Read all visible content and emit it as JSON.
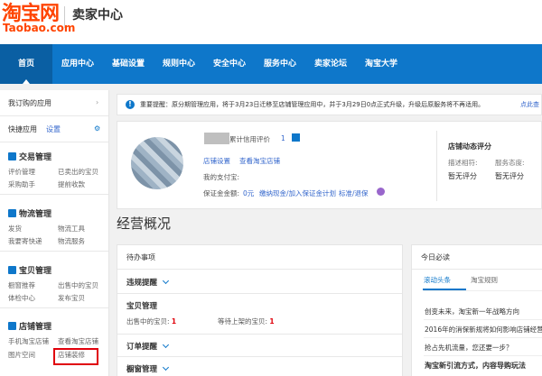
{
  "header": {
    "logo_cn": "淘宝网",
    "logo_en": "Taobao.com",
    "title": "卖家中心"
  },
  "nav": [
    "首页",
    "应用中心",
    "基础设置",
    "规则中心",
    "安全中心",
    "服务中心",
    "卖家论坛",
    "淘宝大学"
  ],
  "sidebar": {
    "my_apps": "我订购的应用",
    "quick": "快捷应用",
    "settings": "设置",
    "sections": [
      {
        "title": "交易管理",
        "links": [
          "评价管理",
          "已卖出的宝贝",
          "采购助手",
          "提前收款"
        ]
      },
      {
        "title": "物流管理",
        "links": [
          "发货",
          "物流工具",
          "我要寄快递",
          "物流服务"
        ]
      },
      {
        "title": "宝贝管理",
        "links": [
          "橱窗推荐",
          "出售中的宝贝",
          "体检中心",
          "发布宝贝"
        ]
      },
      {
        "title": "店铺管理",
        "links": [
          "手机淘宝店铺",
          "查看淘宝店铺",
          "图片空间",
          "店铺装修"
        ]
      }
    ]
  },
  "notice": {
    "icon": "!",
    "text": "重要提醒：原分期管理应用，将于3月23日迁移至店铺管理应用中，并于3月29日0点正式升级，升级后原服务将不再适用。",
    "more": "点此查"
  },
  "profile": {
    "credit_label": "累计信用评价",
    "credit_value": "1",
    "shop_settings": "店铺设置",
    "view_shop": "查看淘宝店铺",
    "alipay": "我的支付宝:",
    "deposit": "保证金金额:",
    "deposit_value": "0元",
    "deposit_links": "缴纳现金/加入保证金计划",
    "deposit_more": "标准/退保",
    "dynamic_title": "店铺动态评分",
    "desc_label": "描述相符:",
    "service_label": "服务态度:",
    "no_score": "暂无评分"
  },
  "overview_title": "经营概况",
  "todo": {
    "title": "待办事项",
    "violation": "违规提醒",
    "item_mgmt": "宝贝管理",
    "selling": "出售中的宝贝:",
    "selling_count": "1",
    "waiting": "等待上架的宝贝:",
    "waiting_count": "1",
    "order": "订单提醒",
    "showcase": "橱窗管理"
  },
  "daily": {
    "title": "今日必读",
    "tabs": [
      "滚动头条",
      "淘宝规则"
    ],
    "news": [
      "创变未来，淘宝新一年战略方向",
      "2016年的消保新规将如何影响店铺经营",
      "抢占先机流量，您还要一步？",
      "淘宝新引流方式，内容导购玩法"
    ]
  },
  "colors": {
    "brand": "#ff4400",
    "nav": "#0e77ca",
    "link": "#3366cc",
    "alert": "#e0000b"
  }
}
